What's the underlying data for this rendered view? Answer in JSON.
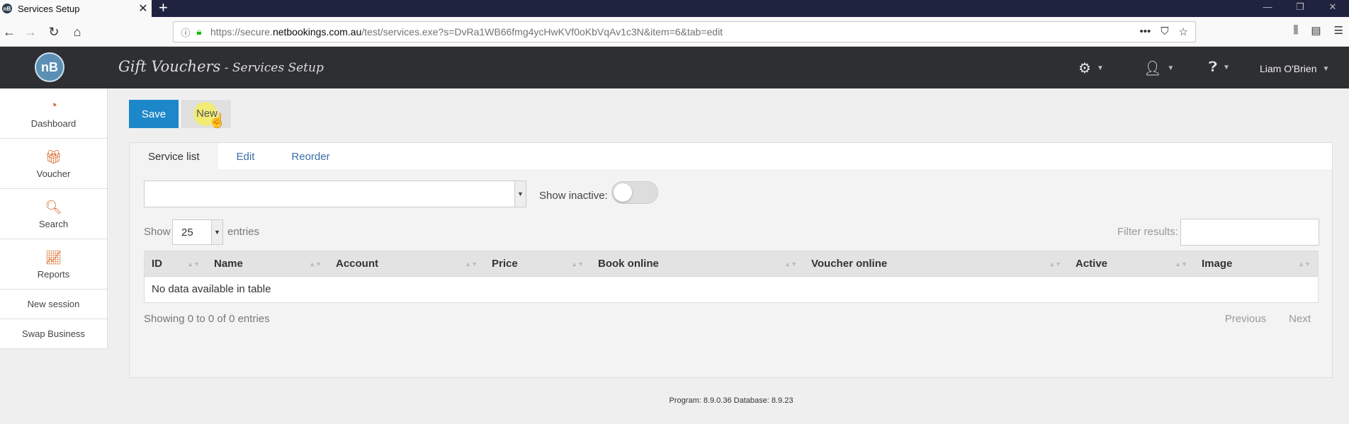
{
  "browser": {
    "tab_title": "Services Setup",
    "url_prefix": "https://secure.",
    "url_domain": "netbookings.com.au",
    "url_rest": "/test/services.exe?s=DvRa1WB66fmg4ycHwKVf0oKbVqAv1c3N&item=6&tab=edit"
  },
  "header": {
    "logo_text": "nB",
    "title": "Gift Vouchers",
    "subtitle": " - Services Setup",
    "user_name": "Liam O'Brien"
  },
  "sidebar": {
    "items": [
      {
        "label": "Dashboard",
        "icon": "dashboard-icon"
      },
      {
        "label": "Voucher",
        "icon": "gift-icon"
      },
      {
        "label": "Search",
        "icon": "search-icon"
      },
      {
        "label": "Reports",
        "icon": "chart-icon"
      }
    ],
    "text_items": [
      "New session",
      "Swap Business"
    ]
  },
  "toolbar": {
    "save_label": "Save",
    "new_label": "New"
  },
  "tabs": [
    "Service list",
    "Edit",
    "Reorder"
  ],
  "filters": {
    "show_inactive_label": "Show inactive:",
    "show_label": "Show",
    "entries_value": "25",
    "entries_label": "entries",
    "filter_label": "Filter results:"
  },
  "table": {
    "columns": [
      "ID",
      "Name",
      "Account",
      "Price",
      "Book online",
      "Voucher online",
      "Active",
      "Image"
    ],
    "empty_text": "No data available in table",
    "info_text": "Showing 0 to 0 of 0 entries",
    "prev_label": "Previous",
    "next_label": "Next"
  },
  "footer": {
    "text": "Program: 8.9.0.36 Database: 8.9.23"
  },
  "colors": {
    "header_bg": "#2e2f33",
    "primary_button": "#1c87c9",
    "sidebar_icon": "#d86b2c",
    "link": "#3a6fa8"
  }
}
